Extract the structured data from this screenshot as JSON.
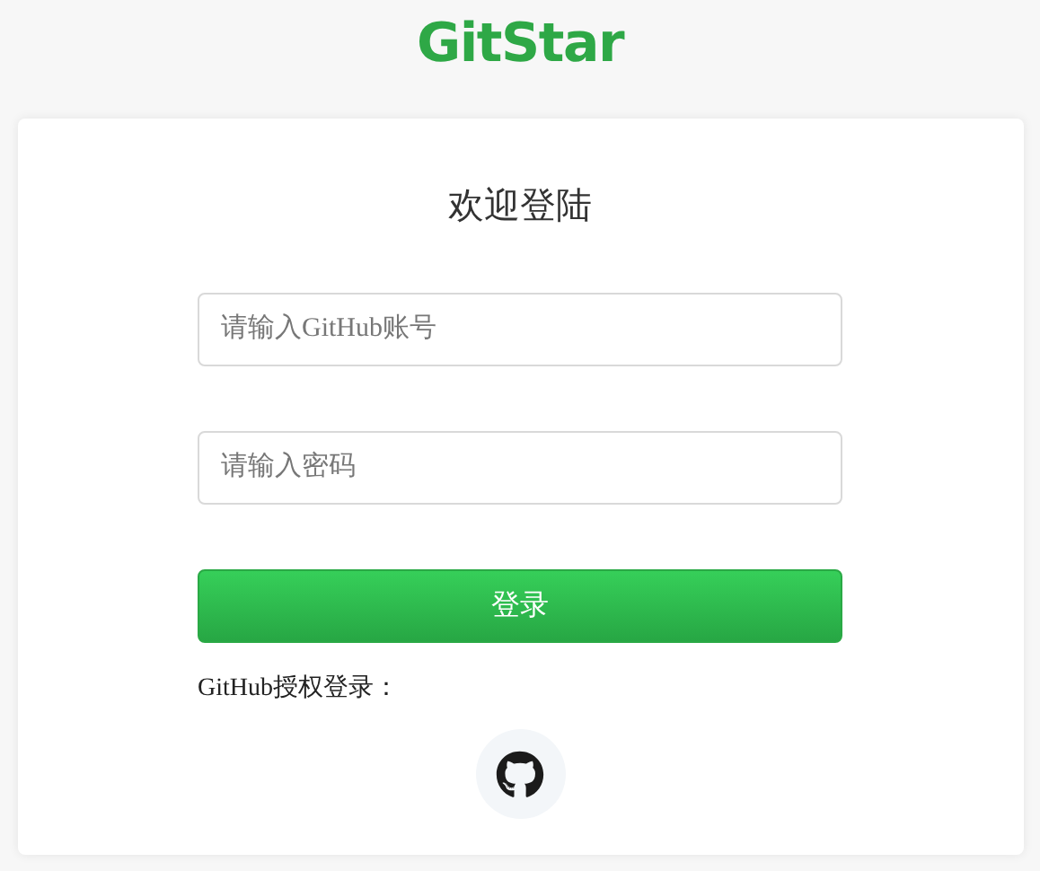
{
  "logo": "GitStar",
  "title": "欢迎登陆",
  "fields": [
    {
      "placeholder": "请输入GitHub账号"
    },
    {
      "placeholder": "请输入密码"
    }
  ],
  "login_button": "登录",
  "oauth_label": "GitHub授权登录："
}
